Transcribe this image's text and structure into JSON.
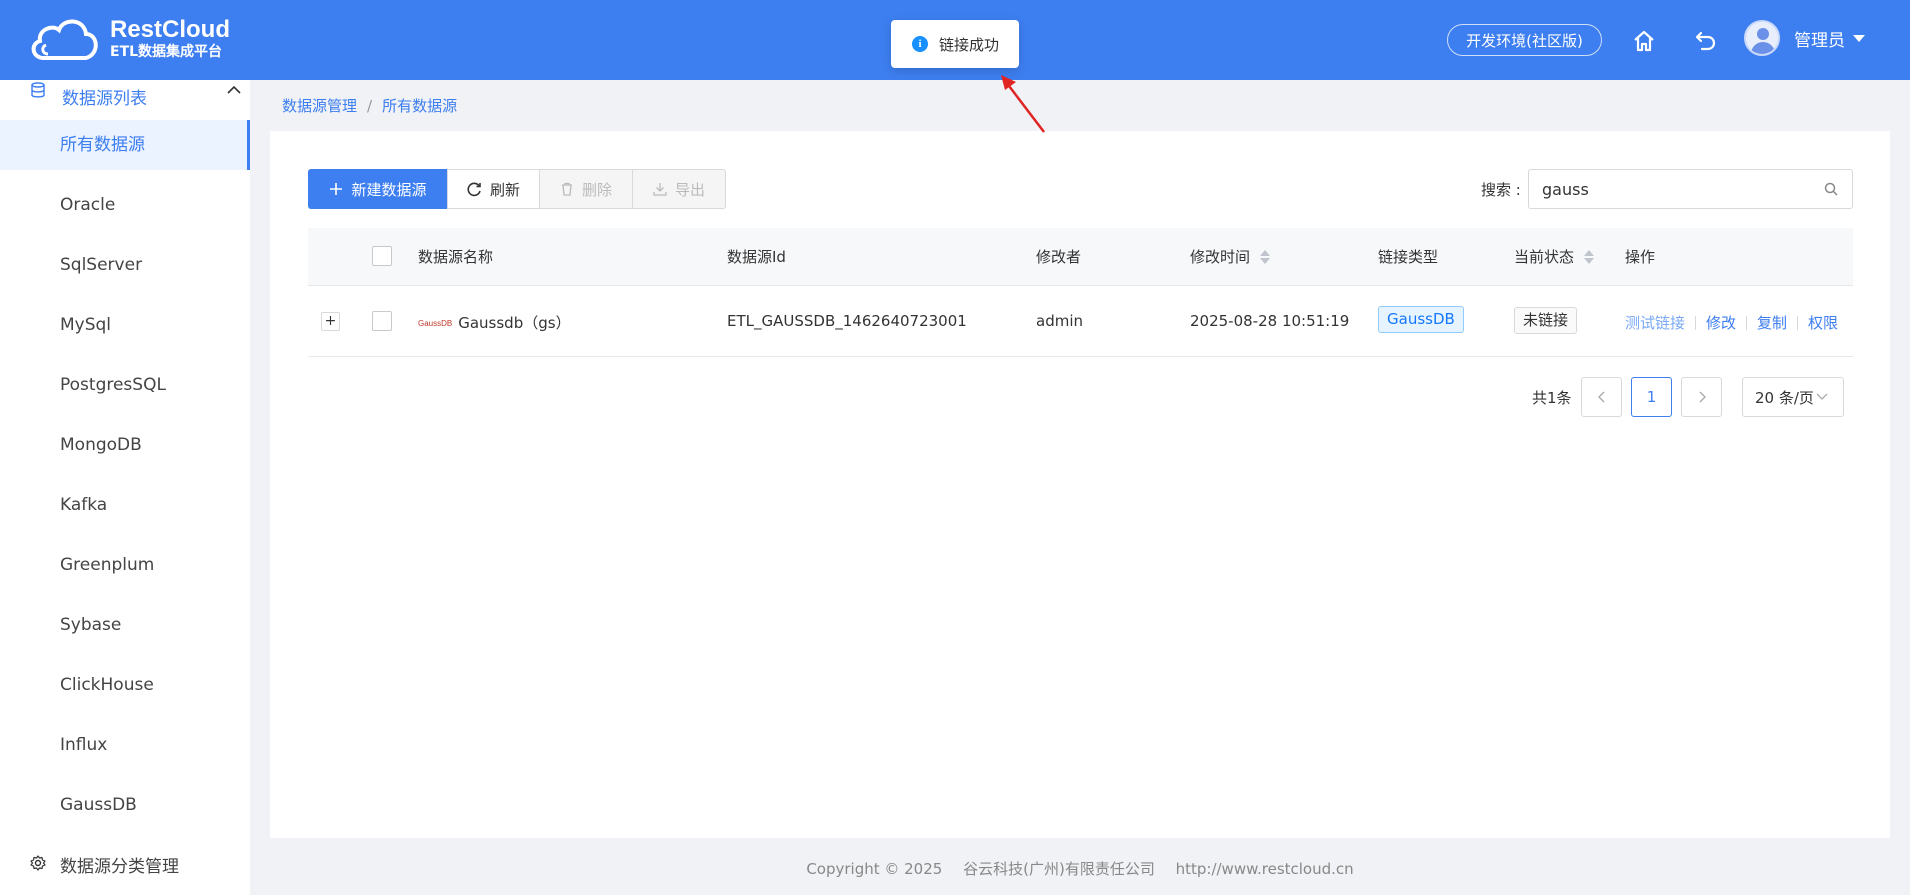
{
  "header": {
    "logo_title": "RestCloud",
    "logo_subtitle": "ETL数据集成平台",
    "env_label": "开发环境(社区版)",
    "user_name": "管理员",
    "brand_color": "#3d7ef0"
  },
  "toast": {
    "message": "链接成功",
    "icon": "info-icon"
  },
  "sidebar": {
    "group_label": "数据源列表",
    "items": [
      {
        "label": "所有数据源",
        "active": true
      },
      {
        "label": "Oracle"
      },
      {
        "label": "SqlServer"
      },
      {
        "label": "MySql"
      },
      {
        "label": "PostgresSQL"
      },
      {
        "label": "MongoDB"
      },
      {
        "label": "Kafka"
      },
      {
        "label": "Greenplum"
      },
      {
        "label": "Sybase"
      },
      {
        "label": "ClickHouse"
      },
      {
        "label": "Influx"
      },
      {
        "label": "GaussDB"
      }
    ],
    "footer_label": "数据源分类管理"
  },
  "breadcrumb": [
    "数据源管理",
    "所有数据源"
  ],
  "toolbar": {
    "new_label": "新建数据源",
    "refresh_label": "刷新",
    "delete_label": "删除",
    "export_label": "导出"
  },
  "search": {
    "label": "搜索 :",
    "value": "gauss"
  },
  "table": {
    "columns": [
      "数据源名称",
      "数据源Id",
      "修改者",
      "修改时间",
      "链接类型",
      "当前状态",
      "操作"
    ],
    "rows": [
      {
        "expand": "+",
        "logo_text": "GaussDB",
        "name": "Gaussdb（gs）",
        "id": "ETL_GAUSSDB_1462640723001",
        "modifier": "admin",
        "modified_time": "2025-08-28 10:51:19",
        "type": "GaussDB",
        "status": "未链接",
        "actions": [
          "测试链接",
          "修改",
          "复制",
          "权限"
        ]
      }
    ]
  },
  "pagination": {
    "total": "共1条",
    "current_page": "1",
    "page_size": "20 条/页"
  },
  "footer": {
    "copyright": "Copyright © 2025",
    "company": "谷云科技(广州)有限责任公司",
    "url": "http://www.restcloud.cn"
  }
}
